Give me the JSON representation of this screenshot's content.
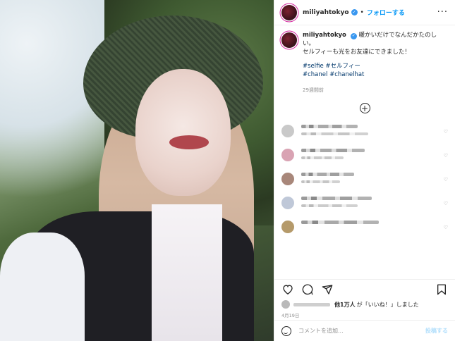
{
  "header": {
    "username": "miliyahtokyo",
    "separator": "•",
    "follow_label": "フォローする",
    "more_label": "···"
  },
  "caption": {
    "username": "miliyahtokyo",
    "text_line1": "暖かいだけでなんだかたのしい。",
    "text_line2": "セルフィーも光をお友達にできました！",
    "hashtags_line1": "#selfie #セルフィー",
    "hashtags_line2": "#chanel #chanelhat",
    "time": "29週間前"
  },
  "likes": {
    "count_label": "他1万人",
    "text": "が「いいね！」しました"
  },
  "date": "4月19日",
  "comment_box": {
    "placeholder": "コメントを追加...",
    "post_label": "投稿する"
  },
  "icons": [
    "verified-icon",
    "more-options-icon",
    "load-more-icon",
    "heart-icon",
    "comment-icon",
    "share-icon",
    "bookmark-icon",
    "emoji-icon"
  ]
}
